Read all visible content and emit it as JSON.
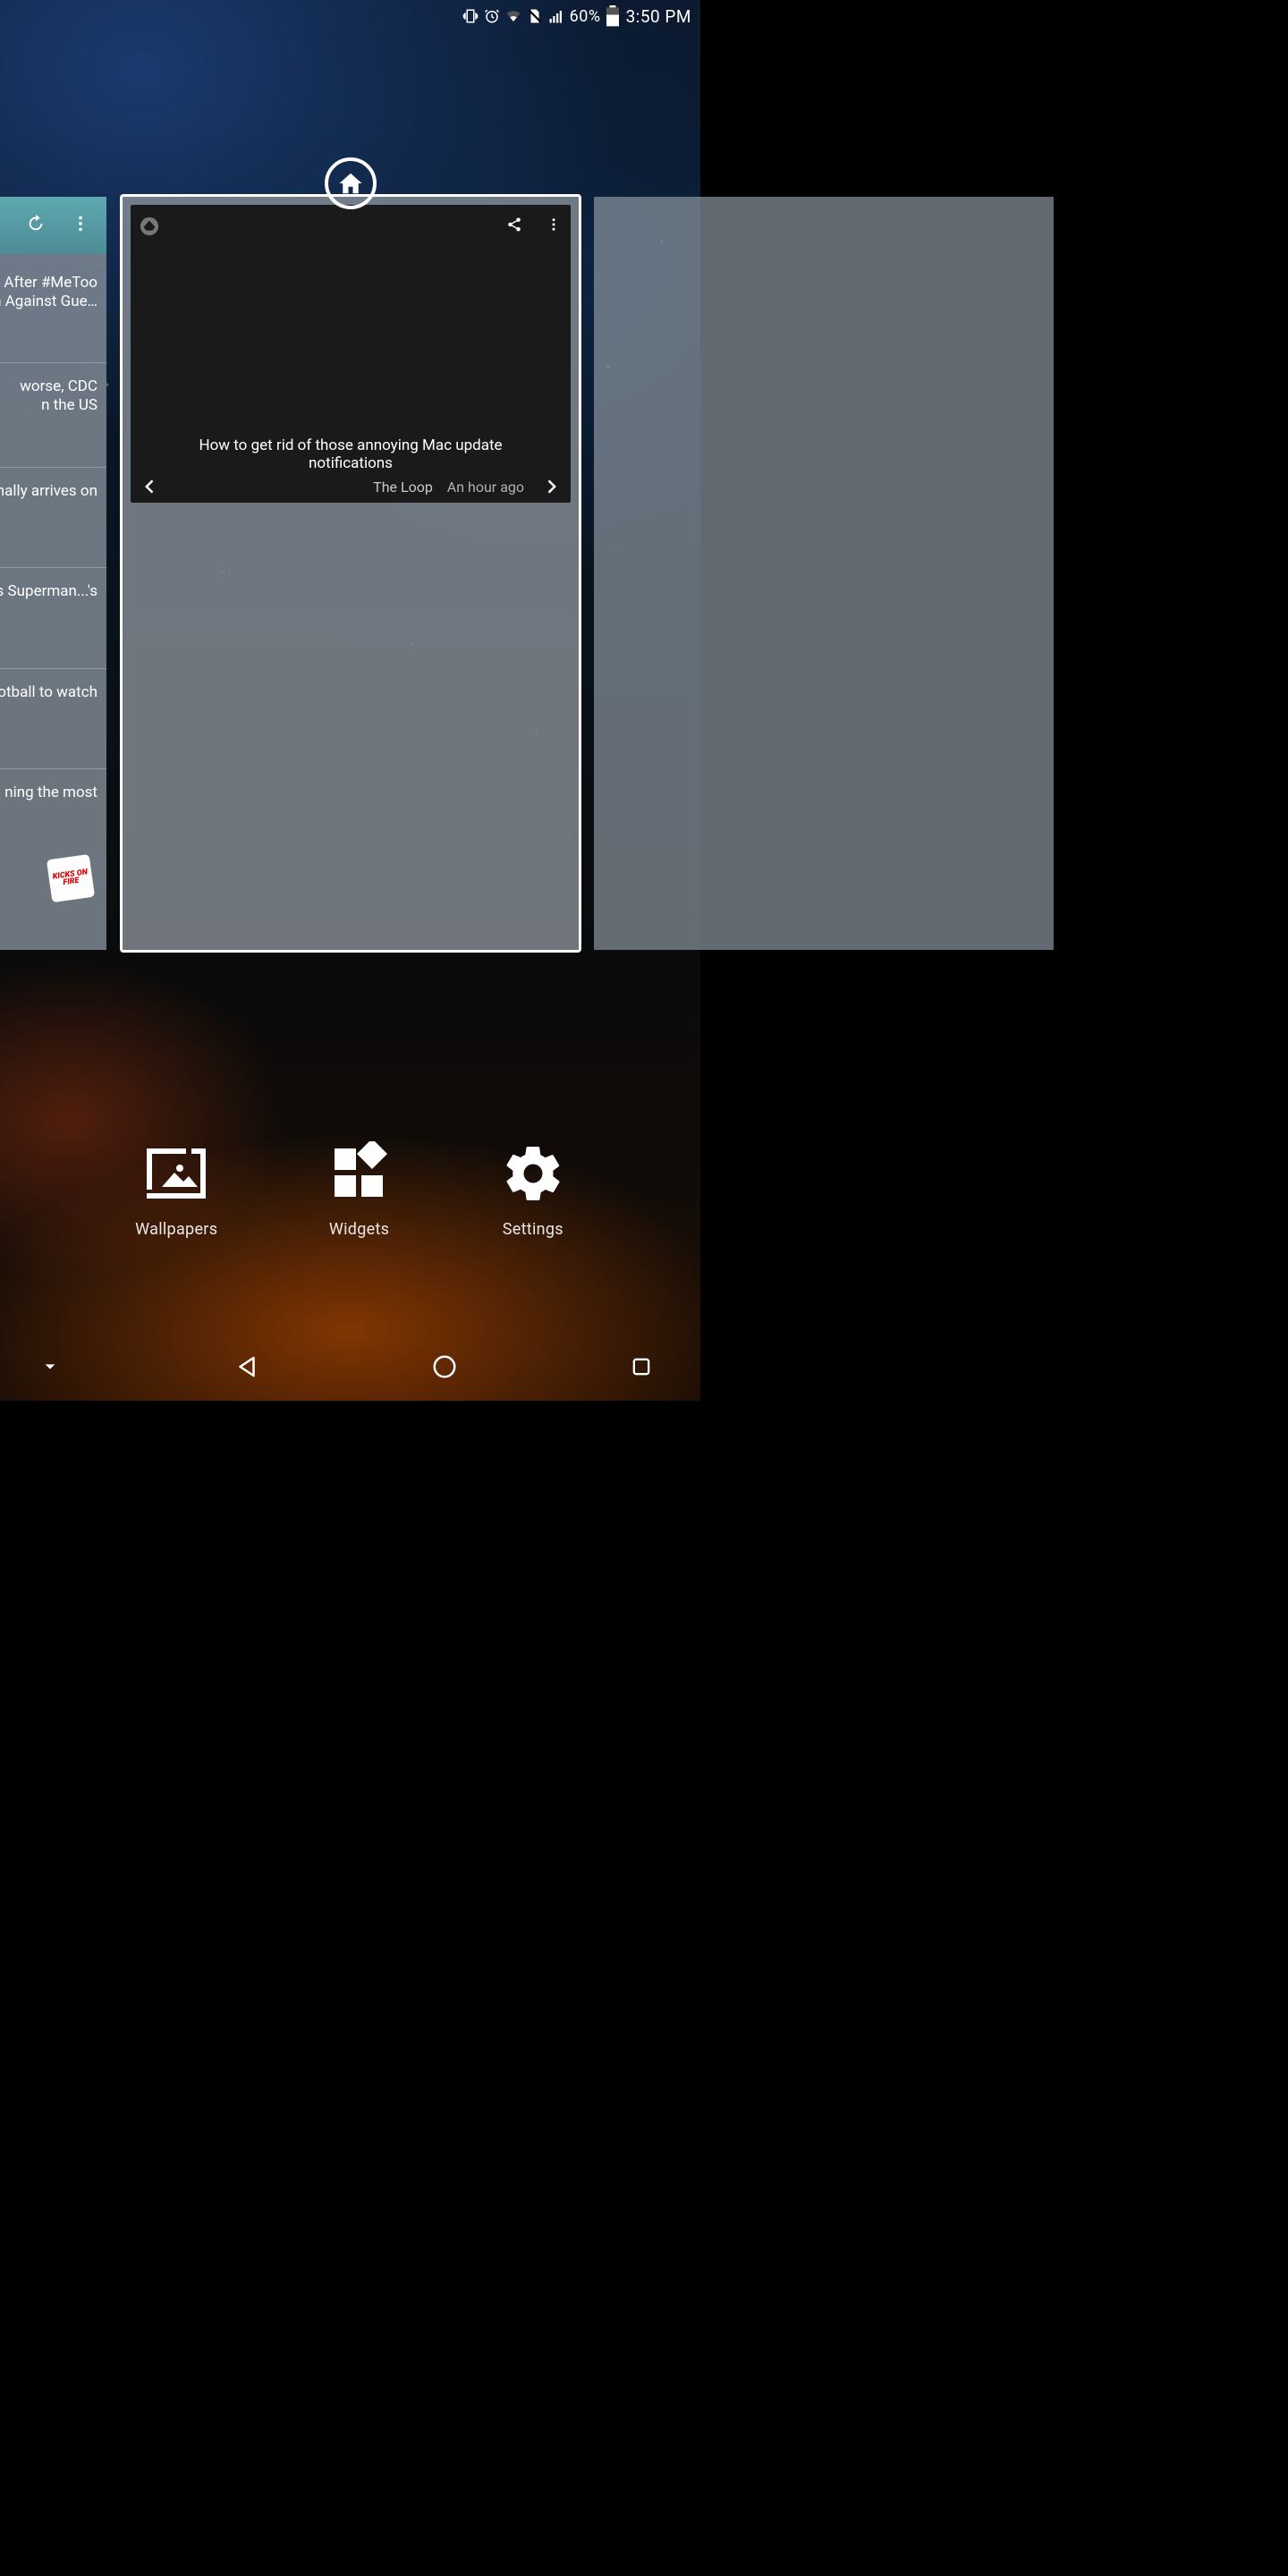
{
  "status": {
    "battery_pct": "60%",
    "clock": "3:50 PM"
  },
  "left_panel": {
    "rows": [
      "After #MeToo\nim Against Gue…",
      "worse, CDC\nn the US",
      "nally arrives on",
      "es Superman...'s",
      "ootball to watch",
      "ning the most"
    ],
    "logo_text": "KICKS ON FIRE"
  },
  "center_widget": {
    "title": "How to get rid of those annoying Mac update notifications",
    "source": "The Loop",
    "age": "An hour ago"
  },
  "actions": {
    "wallpapers": "Wallpapers",
    "widgets": "Widgets",
    "settings": "Settings"
  }
}
